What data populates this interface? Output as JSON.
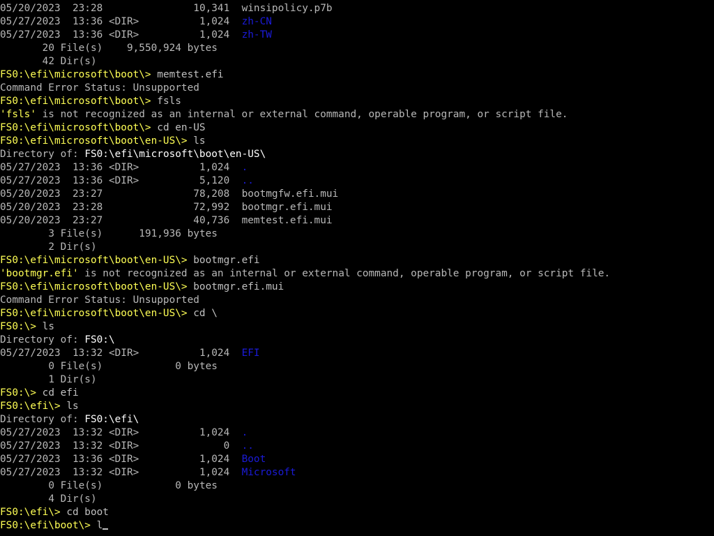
{
  "colors": {
    "background": "#000000",
    "text": "#b8b8b8",
    "prompt": "#ffff55",
    "highlight": "#ffffff",
    "directory_name": "#1b1bd8"
  },
  "lines": [
    {
      "kind": "entry",
      "date": "05/20/2023",
      "time": "23:28",
      "tag": "",
      "size": "10,341",
      "name": "winsipolicy.p7b",
      "is_dir": false
    },
    {
      "kind": "entry",
      "date": "05/27/2023",
      "time": "13:36",
      "tag": "<DIR>",
      "size": "1,024",
      "name": "zh-CN",
      "is_dir": true
    },
    {
      "kind": "entry",
      "date": "05/27/2023",
      "time": "13:36",
      "tag": "<DIR>",
      "size": "1,024",
      "name": "zh-TW",
      "is_dir": true
    },
    {
      "kind": "summary",
      "count": "20",
      "unit": "File(s)",
      "bytes": "9,550,924",
      "suffix": "bytes"
    },
    {
      "kind": "summary",
      "count": "42",
      "unit": "Dir(s)",
      "bytes": "",
      "suffix": ""
    },
    {
      "kind": "prompt",
      "prompt": "FS0:\\efi\\microsoft\\boot\\>",
      "command": "memtest.efi"
    },
    {
      "kind": "text",
      "text": "Command Error Status: Unsupported"
    },
    {
      "kind": "prompt",
      "prompt": "FS0:\\efi\\microsoft\\boot\\>",
      "command": "fsls"
    },
    {
      "kind": "error",
      "quoted": "'fsls'",
      "rest": " is not recognized as an internal or external command, operable program, or script file."
    },
    {
      "kind": "prompt",
      "prompt": "FS0:\\efi\\microsoft\\boot\\>",
      "command": "cd en-US"
    },
    {
      "kind": "prompt",
      "prompt": "FS0:\\efi\\microsoft\\boot\\en-US\\>",
      "command": "ls"
    },
    {
      "kind": "dirof",
      "label": "Directory of:",
      "path": "FS0:\\efi\\microsoft\\boot\\en-US\\"
    },
    {
      "kind": "entry",
      "date": "05/27/2023",
      "time": "13:36",
      "tag": "<DIR>",
      "size": "1,024",
      "name": ".",
      "is_dir": true
    },
    {
      "kind": "entry",
      "date": "05/27/2023",
      "time": "13:36",
      "tag": "<DIR>",
      "size": "5,120",
      "name": "..",
      "is_dir": true
    },
    {
      "kind": "entry",
      "date": "05/20/2023",
      "time": "23:27",
      "tag": "",
      "size": "78,208",
      "name": "bootmgfw.efi.mui",
      "is_dir": false
    },
    {
      "kind": "entry",
      "date": "05/20/2023",
      "time": "23:28",
      "tag": "",
      "size": "72,992",
      "name": "bootmgr.efi.mui",
      "is_dir": false
    },
    {
      "kind": "entry",
      "date": "05/20/2023",
      "time": "23:27",
      "tag": "",
      "size": "40,736",
      "name": "memtest.efi.mui",
      "is_dir": false
    },
    {
      "kind": "summary",
      "count": "3",
      "unit": "File(s)",
      "bytes": "191,936",
      "suffix": "bytes"
    },
    {
      "kind": "summary",
      "count": "2",
      "unit": "Dir(s)",
      "bytes": "",
      "suffix": ""
    },
    {
      "kind": "prompt",
      "prompt": "FS0:\\efi\\microsoft\\boot\\en-US\\>",
      "command": "bootmgr.efi"
    },
    {
      "kind": "error",
      "quoted": "'bootmgr.efi'",
      "rest": " is not recognized as an internal or external command, operable program, or script file."
    },
    {
      "kind": "prompt",
      "prompt": "FS0:\\efi\\microsoft\\boot\\en-US\\>",
      "command": "bootmgr.efi.mui"
    },
    {
      "kind": "text",
      "text": "Command Error Status: Unsupported"
    },
    {
      "kind": "prompt",
      "prompt": "FS0:\\efi\\microsoft\\boot\\en-US\\>",
      "command": "cd \\"
    },
    {
      "kind": "prompt",
      "prompt": "FS0:\\>",
      "command": "ls"
    },
    {
      "kind": "dirof",
      "label": "Directory of:",
      "path": "FS0:\\"
    },
    {
      "kind": "entry",
      "date": "05/27/2023",
      "time": "13:32",
      "tag": "<DIR>",
      "size": "1,024",
      "name": "EFI",
      "is_dir": true
    },
    {
      "kind": "summary",
      "count": "0",
      "unit": "File(s)",
      "bytes": "0",
      "suffix": "bytes"
    },
    {
      "kind": "summary",
      "count": "1",
      "unit": "Dir(s)",
      "bytes": "",
      "suffix": ""
    },
    {
      "kind": "prompt",
      "prompt": "FS0:\\>",
      "command": "cd efi"
    },
    {
      "kind": "prompt",
      "prompt": "FS0:\\efi\\>",
      "command": "ls"
    },
    {
      "kind": "dirof",
      "label": "Directory of:",
      "path": "FS0:\\efi\\"
    },
    {
      "kind": "entry",
      "date": "05/27/2023",
      "time": "13:32",
      "tag": "<DIR>",
      "size": "1,024",
      "name": ".",
      "is_dir": true
    },
    {
      "kind": "entry",
      "date": "05/27/2023",
      "time": "13:32",
      "tag": "<DIR>",
      "size": "0",
      "name": "..",
      "is_dir": true
    },
    {
      "kind": "entry",
      "date": "05/27/2023",
      "time": "13:36",
      "tag": "<DIR>",
      "size": "1,024",
      "name": "Boot",
      "is_dir": true
    },
    {
      "kind": "entry",
      "date": "05/27/2023",
      "time": "13:32",
      "tag": "<DIR>",
      "size": "1,024",
      "name": "Microsoft",
      "is_dir": true
    },
    {
      "kind": "summary",
      "count": "0",
      "unit": "File(s)",
      "bytes": "0",
      "suffix": "bytes"
    },
    {
      "kind": "summary",
      "count": "4",
      "unit": "Dir(s)",
      "bytes": "",
      "suffix": ""
    },
    {
      "kind": "prompt",
      "prompt": "FS0:\\efi\\>",
      "command": "cd boot"
    },
    {
      "kind": "input",
      "prompt": "FS0:\\efi\\boot\\>",
      "command": "l"
    }
  ]
}
